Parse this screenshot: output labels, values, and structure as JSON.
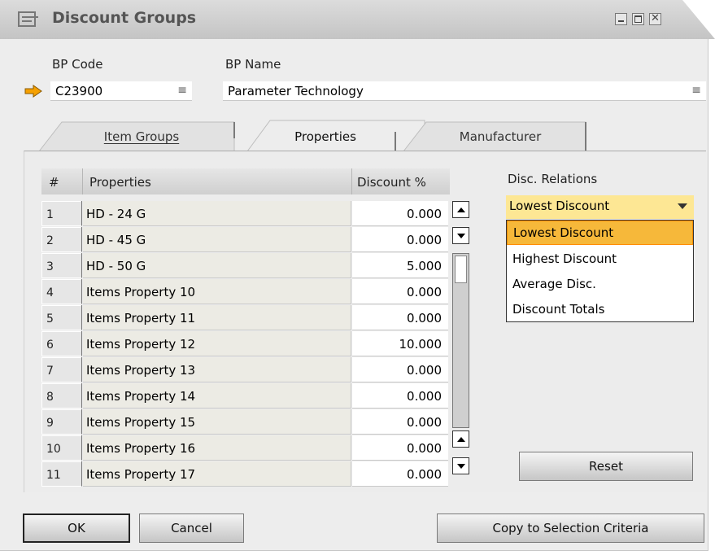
{
  "window": {
    "title": "Discount Groups"
  },
  "header": {
    "bp_code_label": "BP Code",
    "bp_code_value": "C23900",
    "bp_name_label": "BP Name",
    "bp_name_value": "Parameter Technology",
    "field_menu_glyph": "≡"
  },
  "tabs": [
    {
      "label": "Item Groups",
      "active": false
    },
    {
      "label": "Properties",
      "active": true
    },
    {
      "label": "Manufacturer",
      "active": false
    }
  ],
  "grid": {
    "headers": {
      "num": "#",
      "properties": "Properties",
      "discount": "Discount %"
    },
    "rows": [
      {
        "num": "1",
        "property": "HD - 24 G",
        "discount": "0.000"
      },
      {
        "num": "2",
        "property": "HD - 45 G",
        "discount": "0.000"
      },
      {
        "num": "3",
        "property": "HD - 50 G",
        "discount": "5.000"
      },
      {
        "num": "4",
        "property": "Items Property 10",
        "discount": "0.000"
      },
      {
        "num": "5",
        "property": "Items Property 11",
        "discount": "0.000"
      },
      {
        "num": "6",
        "property": "Items Property 12",
        "discount": "10.000"
      },
      {
        "num": "7",
        "property": "Items Property 13",
        "discount": "0.000"
      },
      {
        "num": "8",
        "property": "Items Property 14",
        "discount": "0.000"
      },
      {
        "num": "9",
        "property": "Items Property 15",
        "discount": "0.000"
      },
      {
        "num": "10",
        "property": "Items Property 16",
        "discount": "0.000"
      },
      {
        "num": "11",
        "property": "Items Property 17",
        "discount": "0.000"
      }
    ]
  },
  "relations": {
    "label": "Disc. Relations",
    "selected": "Lowest Discount",
    "options": [
      "Lowest Discount",
      "Highest Discount",
      "Average Disc.",
      "Discount Totals"
    ]
  },
  "buttons": {
    "reset": "Reset",
    "ok": "OK",
    "cancel": "Cancel",
    "copy": "Copy to Selection Criteria"
  },
  "colors": {
    "combo_bg": "#fde794",
    "selected_item": "#f6b83a",
    "arrow": "#f5a000"
  }
}
